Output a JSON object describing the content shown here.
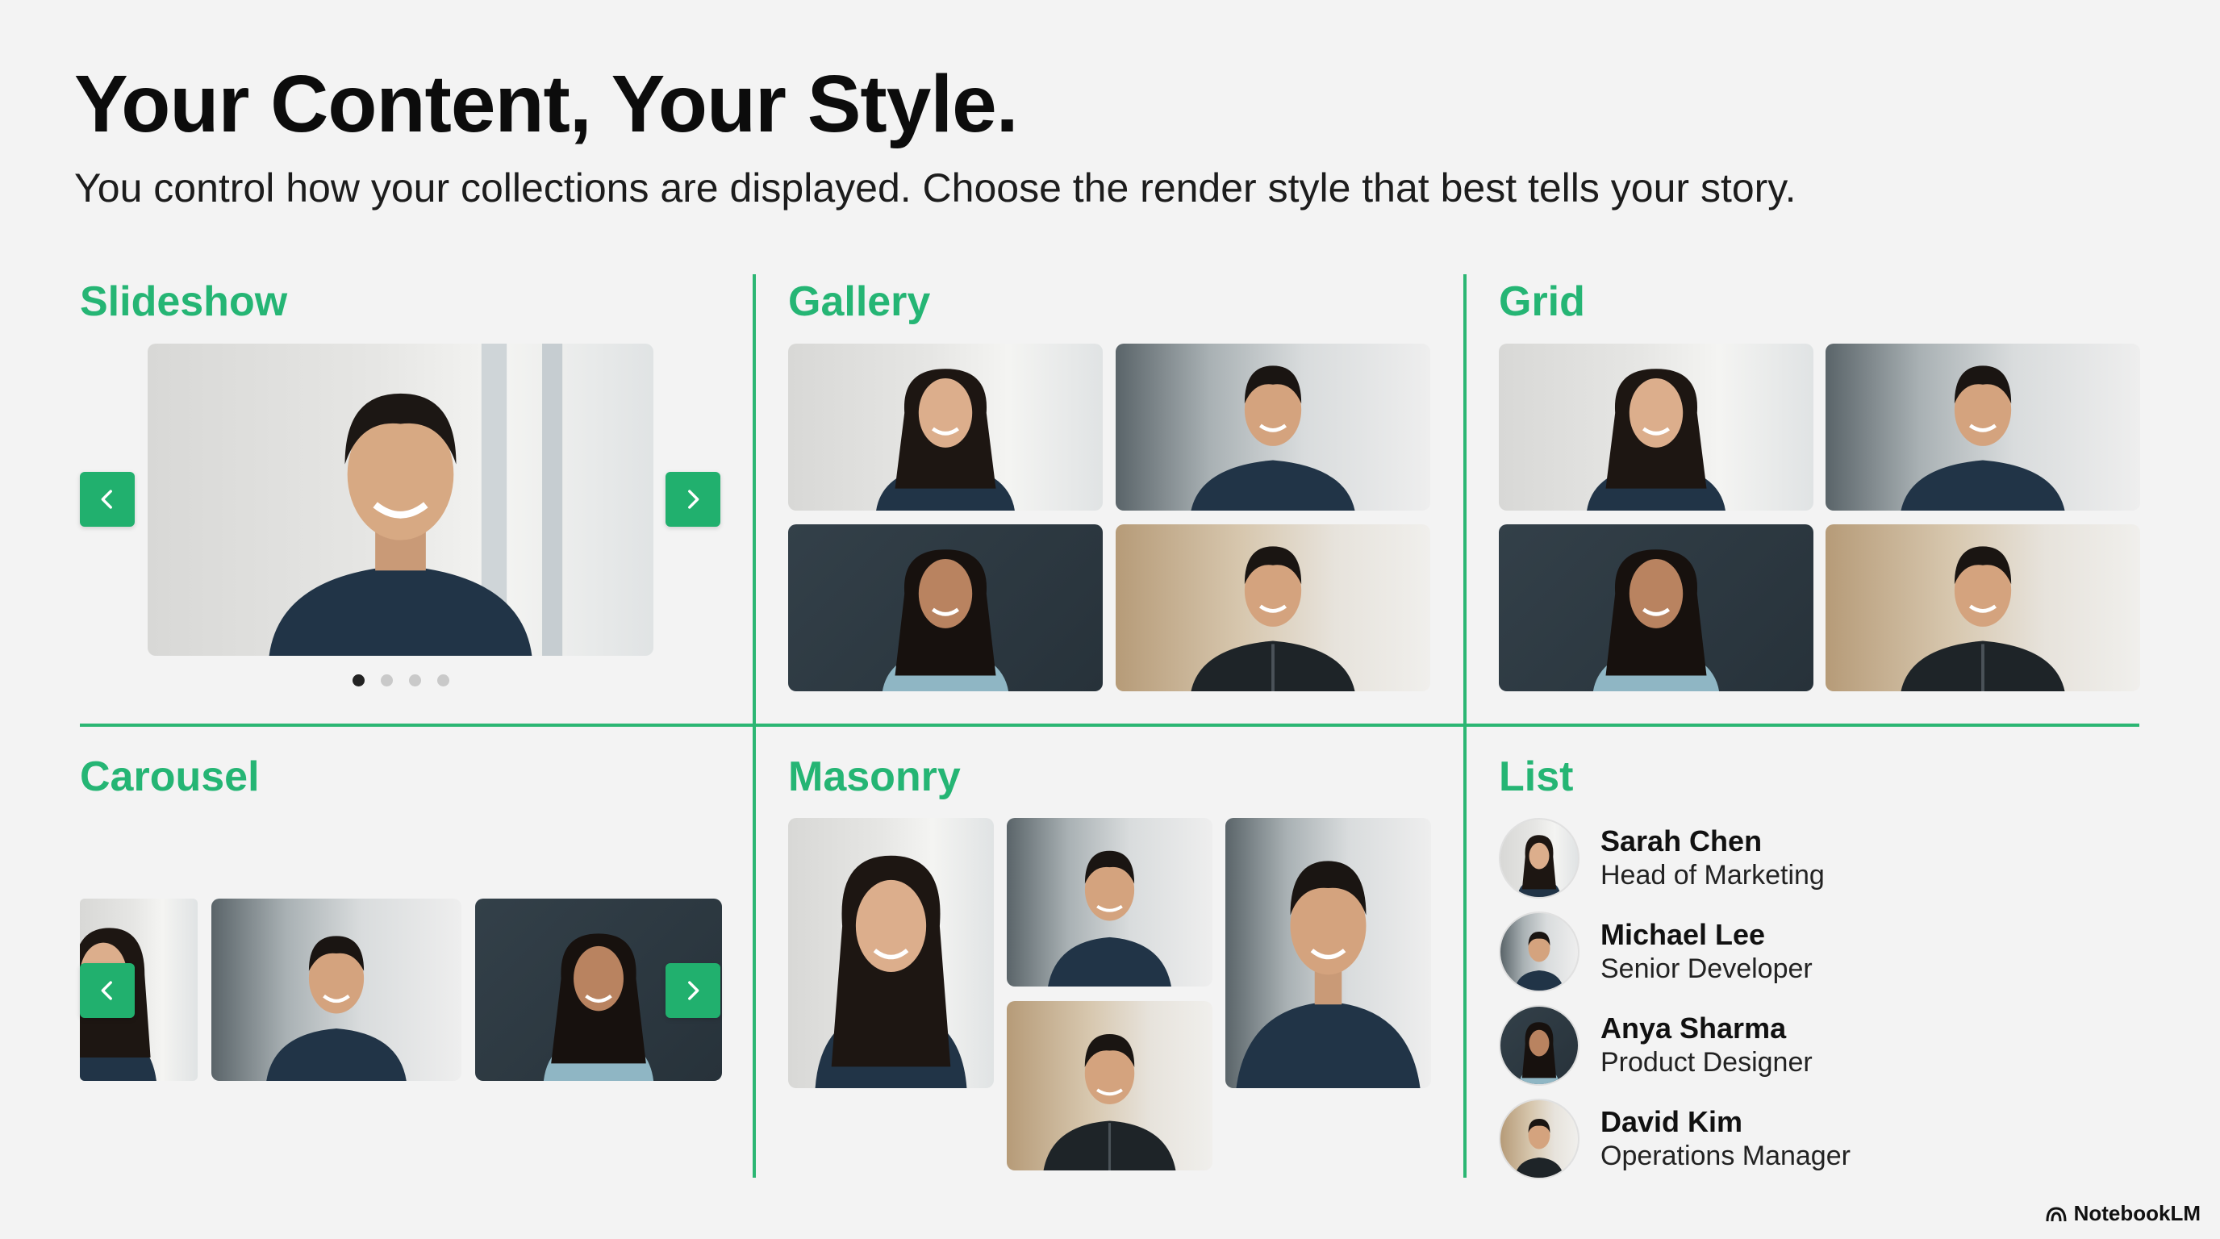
{
  "header": {
    "title": "Your Content, Your Style.",
    "subtitle": "You control how your collections are displayed. Choose the render style that best tells your story."
  },
  "sections": {
    "slideshow": "Slideshow",
    "gallery": "Gallery",
    "grid": "Grid",
    "carousel": "Carousel",
    "masonry": "Masonry",
    "list": "List"
  },
  "slideshow": {
    "slide_count": 4,
    "active_index": 0
  },
  "list_items": [
    {
      "name": "Sarah Chen",
      "role": "Head of Marketing"
    },
    {
      "name": "Michael Lee",
      "role": "Senior Developer"
    },
    {
      "name": "Anya Sharma",
      "role": "Product Designer"
    },
    {
      "name": "David Kim",
      "role": "Operations Manager"
    }
  ],
  "icons": {
    "prev": "chevron-left-icon",
    "next": "chevron-right-icon",
    "brand": "notebooklm-logo-icon"
  },
  "colors": {
    "accent": "#25b574",
    "button": "#21b06e",
    "background": "#f3f3f3",
    "shirt_navy": "#213447"
  },
  "footer": {
    "brand": "NotebookLM"
  }
}
